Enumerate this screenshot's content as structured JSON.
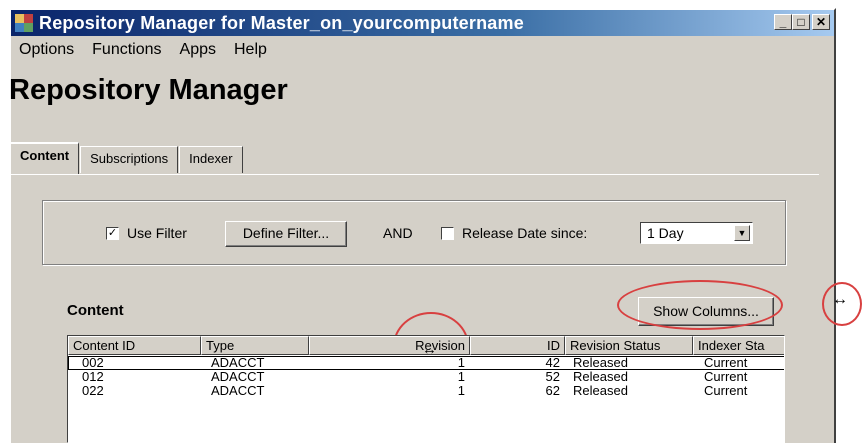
{
  "window": {
    "title": "Repository Manager for Master_on_yourcomputername",
    "minimize": "_",
    "maximize": "□",
    "close": "✕"
  },
  "menu": [
    "Options",
    "Functions",
    "Apps",
    "Help"
  ],
  "heading": "Repository Manager",
  "tabs": [
    {
      "label": "Content",
      "active": true
    },
    {
      "label": "Subscriptions",
      "active": false
    },
    {
      "label": "Indexer",
      "active": false
    }
  ],
  "filter": {
    "use_filter_label": "Use Filter",
    "use_filter_checked": true,
    "define_filter_label": "Define Filter...",
    "and_label": "AND",
    "release_date_label": "Release Date since:",
    "release_date_checked": false,
    "period_value": "1 Day"
  },
  "content": {
    "heading": "Content",
    "show_columns_label": "Show Columns..."
  },
  "table": {
    "columns": [
      "Content ID",
      "Type",
      "Revision",
      "ID",
      "Revision Status",
      "Indexer Sta"
    ],
    "rows": [
      [
        "002",
        "ADACCT",
        "1",
        "42",
        "Released",
        "Current"
      ],
      [
        "012",
        "ADACCT",
        "1",
        "52",
        "Released",
        "Current"
      ],
      [
        "022",
        "ADACCT",
        "1",
        "62",
        "Released",
        "Current"
      ]
    ]
  },
  "icons": {
    "app": "app-icon",
    "checkbox_check": "✓",
    "dropdown_arrow": "▼",
    "resize_cursor": "↔"
  },
  "colors": {
    "titlebar_start": "#0a246a",
    "titlebar_end": "#a6caf0",
    "annotation": "#d84040",
    "face": "#d4d0c8"
  }
}
